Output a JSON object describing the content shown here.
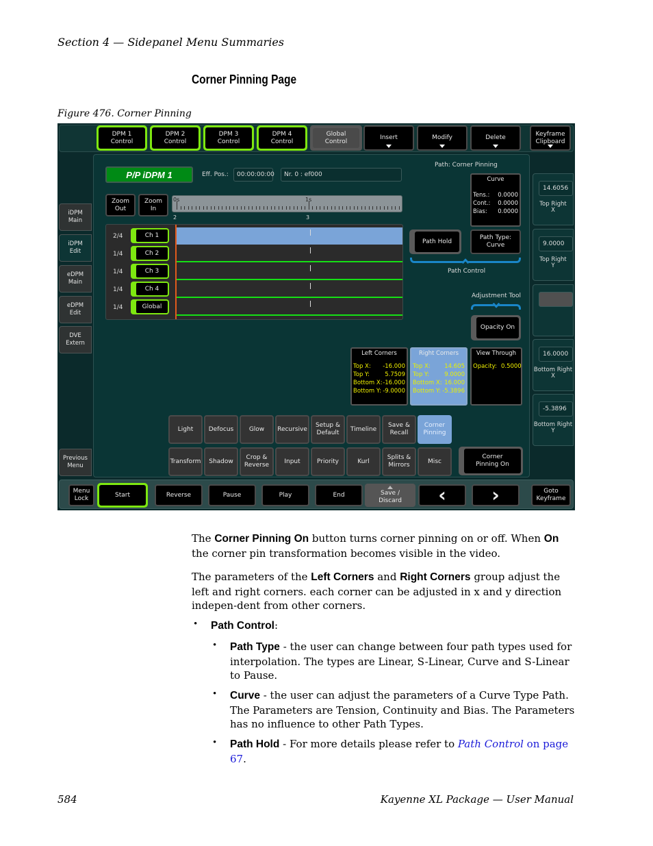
{
  "page": {
    "running_head": "Section 4 — Sidepanel Menu Summaries",
    "section_title": "Corner Pinning Page",
    "figure_caption": "Figure 476.  Corner Pinning",
    "footer_page": "584",
    "footer_title": "Kayenne XL Package — User Manual"
  },
  "ui": {
    "top_buttons": [
      {
        "label": "DPM 1\nControl",
        "style": "green"
      },
      {
        "label": "DPM 2\nControl",
        "style": "green"
      },
      {
        "label": "DPM 3\nControl",
        "style": "green"
      },
      {
        "label": "DPM 4\nControl",
        "style": "green"
      },
      {
        "label": "Global\nControl",
        "style": "gray"
      },
      {
        "label": "Insert",
        "dropdown": true
      },
      {
        "label": "Modify",
        "dropdown": true
      },
      {
        "label": "Delete",
        "dropdown": true
      },
      {
        "label": "Keyframe\nClipboard",
        "dropdown": true
      }
    ],
    "side_tabs": [
      {
        "label": "iDPM\nMain",
        "active": false
      },
      {
        "label": "iDPM\nEdit",
        "active": true
      },
      {
        "label": "eDPM\nMain",
        "active": false
      },
      {
        "label": "eDPM\nEdit",
        "active": false
      },
      {
        "label": "DVE\nExtern",
        "active": false
      },
      {
        "label": "Previous\nMenu",
        "active": false
      }
    ],
    "title": "P/P iDPM 1",
    "eff_pos_label": "Eff. Pos.:",
    "eff_pos_value": "00:00:00:00",
    "nr_value": "Nr. 0 :  ef000",
    "path_label": "Path: Corner Pinning",
    "zoom_out": "Zoom\nOut",
    "zoom_in": "Zoom\nIn",
    "ruler": {
      "top_labels": [
        "0s",
        "1s"
      ],
      "bottom_labels": [
        "2",
        "3"
      ]
    },
    "channels": [
      {
        "fraction": "2/4",
        "label": "Ch 1",
        "selected": true
      },
      {
        "fraction": "1/4",
        "label": "Ch 2",
        "selected": false
      },
      {
        "fraction": "1/4",
        "label": "Ch 3",
        "selected": false
      },
      {
        "fraction": "1/4",
        "label": "Ch 4",
        "selected": false
      },
      {
        "fraction": "1/4",
        "label": "Global",
        "selected": false
      }
    ],
    "curve_box": {
      "title": "Curve",
      "rows": [
        {
          "k": "Tens.:",
          "v": "0.0000"
        },
        {
          "k": "Cont.:",
          "v": "0.0000"
        },
        {
          "k": "Bias:",
          "v": "0.0000"
        }
      ]
    },
    "path_hold": "Path Hold",
    "path_type": "Path Type:\nCurve",
    "path_control_label": "Path Control",
    "adjustment_tool_label": "Adjustment Tool",
    "opacity_on": "Opacity On",
    "left_corners": {
      "title": "Left Corners",
      "rows": [
        {
          "k": "Top X:",
          "v": "-16.000"
        },
        {
          "k": "Top Y:",
          "v": "5.7509"
        },
        {
          "k": "Bottom X:",
          "v": "-16.000"
        },
        {
          "k": "Bottom Y:",
          "v": "-9.0000"
        }
      ]
    },
    "right_corners": {
      "title": "Right Corners",
      "rows": [
        {
          "k": "Top X:",
          "v": "14.605"
        },
        {
          "k": "Top Y:",
          "v": "9.0000"
        },
        {
          "k": "Bottom X:",
          "v": "16.000"
        },
        {
          "k": "Bottom Y:",
          "v": "-5.3896"
        }
      ]
    },
    "view_through": {
      "title": "View Through",
      "rows": [
        {
          "k": "Opacity:",
          "v": "0.5000"
        }
      ]
    },
    "right_params": [
      {
        "value": "14.6056",
        "label": "Top Right\nX"
      },
      {
        "value": "9.0000",
        "label": "Top Right\nY"
      },
      {
        "value": "",
        "label": ""
      },
      {
        "value": "16.0000",
        "label": "Bottom Right\nX"
      },
      {
        "value": "-5.3896",
        "label": "Bottom Right\nY"
      }
    ],
    "menu_row1": [
      "Light",
      "Defocus",
      "Glow",
      "Recursive",
      "Setup &\nDefault",
      "Timeline",
      "Save &\nRecall",
      "Corner\nPinning"
    ],
    "menu_row2": [
      "Transform",
      "Shadow",
      "Crop &\nReverse",
      "Input",
      "Priority",
      "Kurl",
      "Splits &\nMirrors",
      "Misc"
    ],
    "corner_pinning_on": "Corner\nPinning On",
    "bottom_buttons": {
      "menu_lock": "Menu\nLock",
      "start": "Start",
      "reverse": "Reverse",
      "pause": "Pause",
      "play": "Play",
      "end": "End",
      "save_discard": "Save /\nDiscard",
      "prev": "‹",
      "next": "›",
      "goto_keyframe": "Goto\nKeyframe"
    }
  },
  "body": {
    "p1": {
      "t1": "The ",
      "b1": "Corner Pinning On",
      "t2": " button turns corner pinning on or off. When ",
      "b2": "On",
      "t3": " the corner pin transformation becomes visible in the video."
    },
    "p2": {
      "t1": "The parameters of the ",
      "b1": "Left Corners",
      "t2": " and ",
      "b2": "Right Corners",
      "t3": " group adjust the left and right corners. each corner can be adjusted in x and y direction indepen-dent from other corners."
    },
    "bullet_main": {
      "b": "Path Control",
      "t": ":"
    },
    "sub_bullets": [
      {
        "b": "Path Type",
        "t": " - the user can change between four path types used for interpolation. The types are Linear, S-Linear, Curve and S-Linear to Pause."
      },
      {
        "b": "Curve",
        "t": " - the user can adjust the parameters of a Curve Type Path. The Parameters are Tension, Continuity and Bias. The Parameters has no influence to other Path Types."
      },
      {
        "b": "Path Hold",
        "t": " - For more details please refer to "
      }
    ],
    "link_italic": "Path Control",
    "link_rest": " on page 67",
    "end_period": "."
  }
}
